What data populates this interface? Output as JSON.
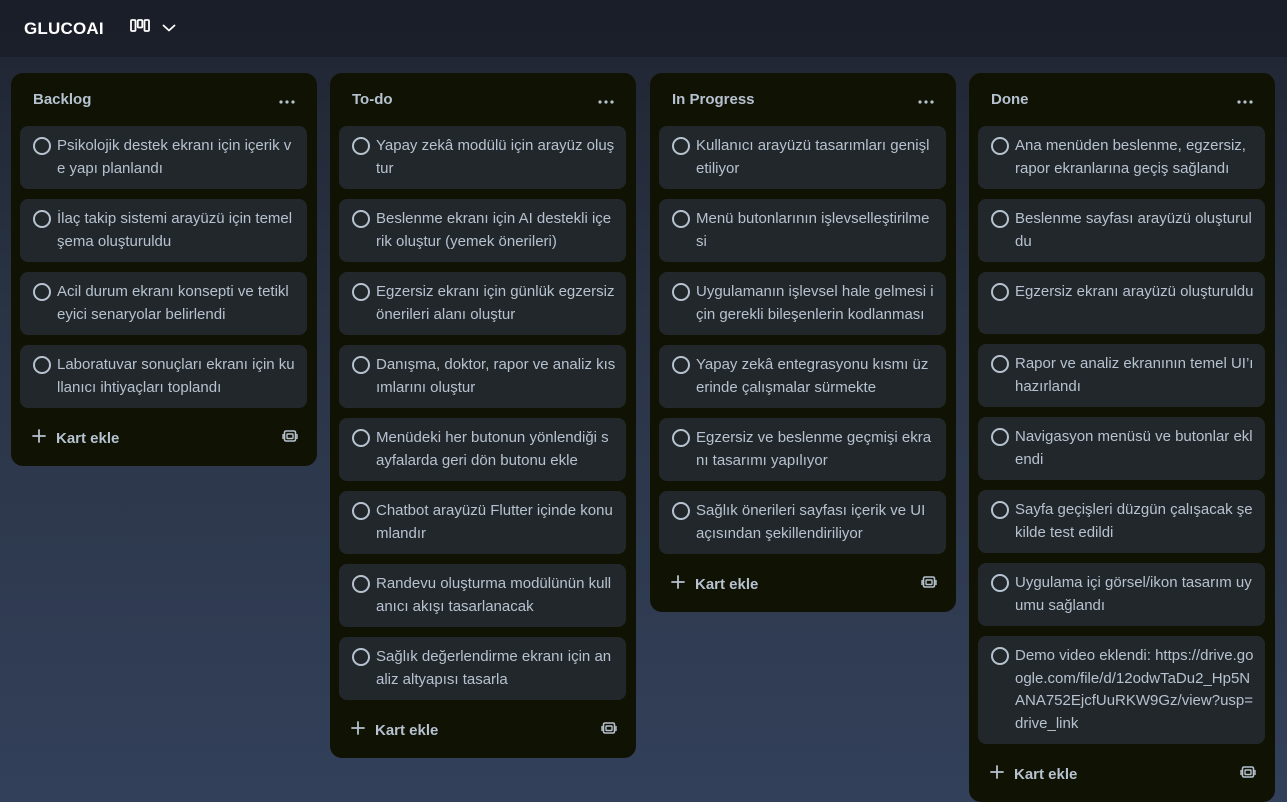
{
  "board": {
    "title": "GLUCOAI",
    "view_icon": "board-view-icon",
    "chevron_icon": "chevron-down-icon"
  },
  "lists": [
    {
      "title": "Backlog",
      "cards": [
        "Psikolojik destek ekranı için içerik ve yapı planlandı",
        "İlaç takip sistemi arayüzü için temel şema oluşturuldu",
        "Acil durum ekranı konsepti ve tetikleyici senaryolar belirlendi",
        "Laboratuvar sonuçları ekranı için kullanıcı ihtiyaçları toplandı"
      ],
      "add_label": "Kart ekle"
    },
    {
      "title": "To-do",
      "cards": [
        "Yapay zekâ modülü için arayüz oluştur",
        "Beslenme ekranı için AI destekli içerik oluştur (yemek önerileri)",
        "Egzersiz ekranı için günlük egzersiz önerileri alanı oluştur",
        "Danışma, doktor, rapor ve analiz kısımlarını oluştur",
        "Menüdeki her butonun yönlendiği sayfalarda geri dön butonu ekle",
        "Chatbot arayüzü Flutter içinde konumlandır",
        "Randevu oluşturma modülünün kullanıcı akışı tasarlanacak",
        "Sağlık değerlendirme ekranı için analiz altyapısı tasarla"
      ],
      "add_label": "Kart ekle"
    },
    {
      "title": "In Progress",
      "cards": [
        "Kullanıcı arayüzü tasarımları genişletiliyor",
        "Menü butonlarının işlevselleştirilmesi",
        "Uygulamanın işlevsel hale gelmesi için gerekli bileşenlerin kodlanması",
        "Yapay zekâ entegrasyonu kısmı üzerinde çalışmalar sürmekte",
        "Egzersiz ve beslenme geçmişi ekranı tasarımı yapılıyor",
        "Sağlık önerileri sayfası içerik ve UI açısından şekillendiriliyor"
      ],
      "add_label": "Kart ekle"
    },
    {
      "title": "Done",
      "cards": [
        "Ana menüden beslenme, egzersiz, rapor ekranlarına geçiş sağlandı",
        "Beslenme sayfası arayüzü oluşturuldu",
        "Egzersiz ekranı arayüzü oluşturuldu",
        "Rapor ve analiz ekranının temel UI’ı hazırlandı",
        "Navigasyon menüsü ve butonlar eklendi",
        "Sayfa geçişleri düzgün çalışacak şekilde test edildi",
        "Uygulama içi görsel/ikon tasarım uyumu sağlandı",
        "Demo video eklendi: https://drive.google.com/file/d/12odwTaDu2_Hp5NANA752EjcfUuRKW9Gz/view?usp=drive_link"
      ],
      "add_label": "Kart ekle"
    }
  ]
}
